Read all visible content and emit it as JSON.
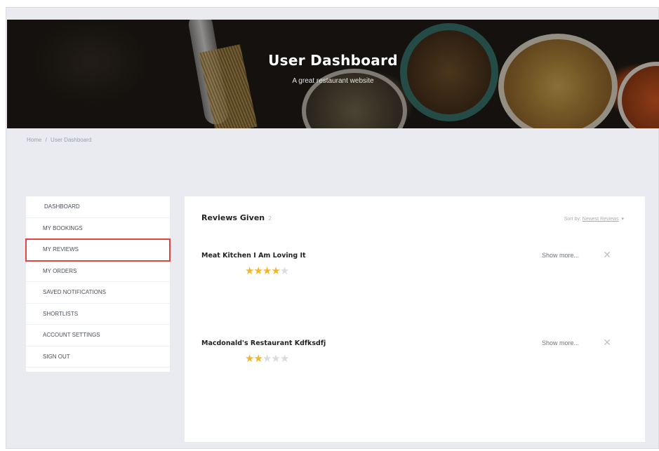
{
  "header": {
    "title": "User Dashboard",
    "subtitle": "A great restaurant website"
  },
  "breadcrumb": {
    "home": "Home",
    "separator": "/",
    "current": "User Dashboard"
  },
  "sidebar": {
    "items": [
      {
        "label": "DASHBOARD"
      },
      {
        "label": "MY BOOKINGS"
      },
      {
        "label": "MY REVIEWS",
        "active": true
      },
      {
        "label": "MY ORDERS"
      },
      {
        "label": "SAVED NOTIFICATIONS"
      },
      {
        "label": "SHORTLISTS"
      },
      {
        "label": "ACCOUNT SETTINGS"
      },
      {
        "label": "SIGN OUT"
      }
    ]
  },
  "reviews": {
    "heading": "Reviews Given",
    "count": "2",
    "sort_label": "Sort by:",
    "sort_value": "Newest Reviews",
    "items": [
      {
        "title": "Meat Kitchen I Am Loving It",
        "rating": 4,
        "max_rating": 5,
        "show_more": "Show more..."
      },
      {
        "title": "Macdonald's Restaurant Kdfksdfj",
        "rating": 2,
        "max_rating": 5,
        "show_more": "Show more..."
      }
    ]
  },
  "colors": {
    "active_outline": "#e04545",
    "star_on": "#f2b62c",
    "star_off": "#d9dbe0"
  }
}
